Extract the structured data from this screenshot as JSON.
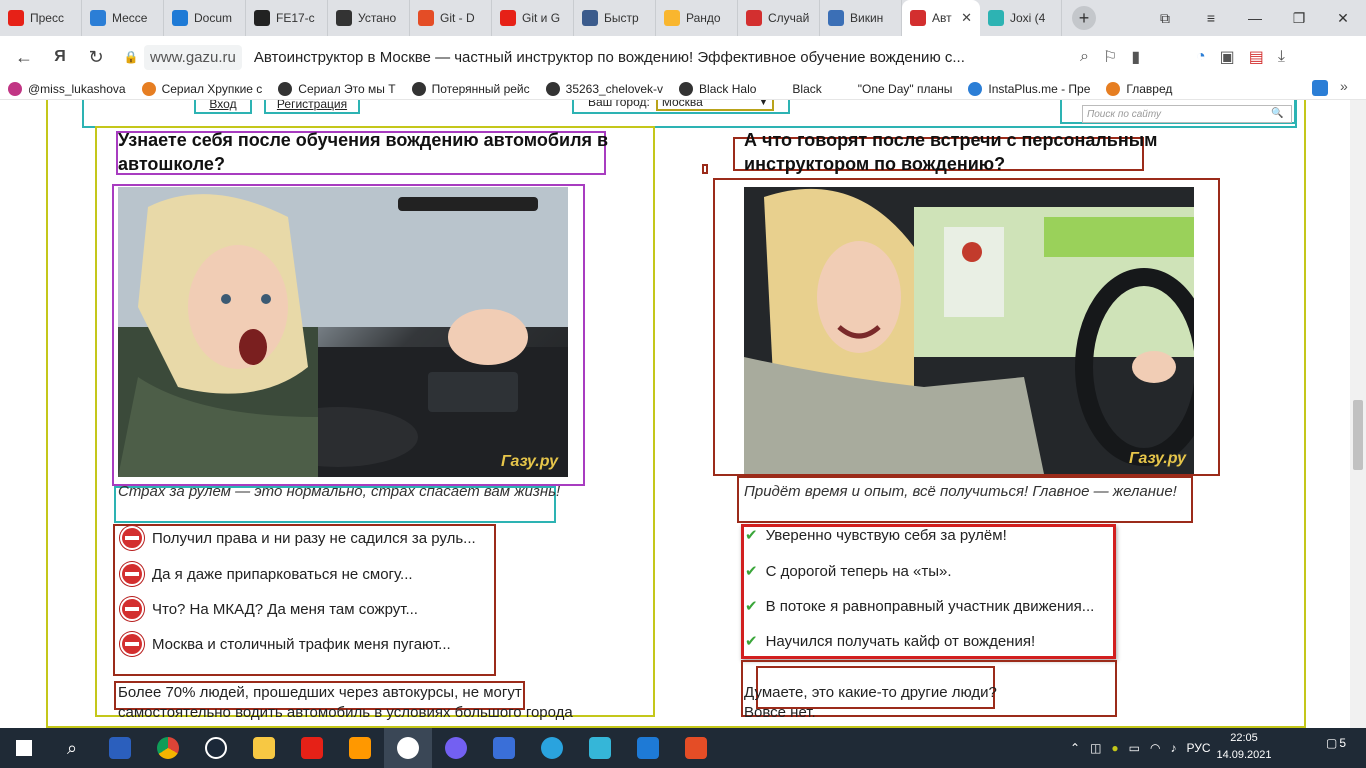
{
  "browser": {
    "tabs": [
      {
        "label": "Пресс",
        "color": "#e62117"
      },
      {
        "label": "Мессе",
        "color": "#2b7ed6"
      },
      {
        "label": "Docum",
        "color": "#1e7ad6"
      },
      {
        "label": "FE17-c",
        "color": "#222222"
      },
      {
        "label": "Устано",
        "color": "#333333"
      },
      {
        "label": "Git - D",
        "color": "#e44d26"
      },
      {
        "label": "Git и G",
        "color": "#e62117"
      },
      {
        "label": "Быстр",
        "color": "#3b5b8c"
      },
      {
        "label": "Рандо",
        "color": "#f9b62e"
      },
      {
        "label": "Случай",
        "color": "#d32f2f"
      },
      {
        "label": "Викин",
        "color": "#3b6fb6"
      },
      {
        "label": "Авт",
        "color": "#d32f2f",
        "active": true
      },
      {
        "label": "Joxi (4",
        "color": "#2db3b3"
      }
    ],
    "new_tab": "+",
    "url": "www.gazu.ru",
    "page_title": "Автоинструктор в Москве — частный инструктор по вождению! Эффективное обучение вождению с...",
    "bookmarks": [
      {
        "label": "@miss_lukashova",
        "color": "#c13584"
      },
      {
        "label": "Сериал Хрупкие с",
        "color": "#e67e22"
      },
      {
        "label": "Сериал Это мы Т",
        "color": "#333333"
      },
      {
        "label": "Потерянный рейс",
        "color": "#333333"
      },
      {
        "label": "35263_chelovek-v",
        "color": "#333333"
      },
      {
        "label": "Black Halo",
        "color": "#333333"
      },
      {
        "label": "Black",
        "color": "#ffffff"
      },
      {
        "label": "\"One Day\" планы",
        "color": "#ffffff"
      },
      {
        "label": "InstaPlus.me - Пре",
        "color": "#2b7ed6"
      },
      {
        "label": "Главред",
        "color": "#e67e22"
      }
    ]
  },
  "site": {
    "login": "Вход",
    "register": "Регистрация",
    "city_label": "Ваш город:",
    "city_value": "Москва",
    "search_placeholder": "Поиск по сайту",
    "left": {
      "heading": "Узнаете себя после обучения вождению автомобиля в автошколе?",
      "caption": "Страх за рулем — это нормально, страх спасает вам жизнь!",
      "items": [
        "Получил права и ни разу не садился за руль...",
        "Да я даже припарковаться не смогу...",
        "Что? На МКАД? Да меня там сожрут...",
        "Москва и столичный трафик меня пугают..."
      ],
      "para_line1": "Более 70% людей, прошедших через автокурсы, не могут",
      "para_line2": "самостоятельно водить автомобиль в условиях большого города",
      "watermark": "Газу.ру"
    },
    "right": {
      "heading": "А что говорят после встречи с персональным инструктором по вождению?",
      "caption": "Придёт время и опыт, всё получиться! Главное — желание!",
      "items": [
        "Уверенно чувствую себя за рулём!",
        "С дорогой теперь на «ты».",
        "В потоке я равноправный участник движения...",
        "Научился получать кайф от вождения!"
      ],
      "para_line1": "Думаете, это какие-то другие люди?",
      "para_line2": "Вовсе нет.",
      "watermark": "Газу.ру"
    }
  },
  "taskbar": {
    "language": "РУС",
    "time": "22:05",
    "date": "14.09.2021",
    "notifications": "5"
  }
}
